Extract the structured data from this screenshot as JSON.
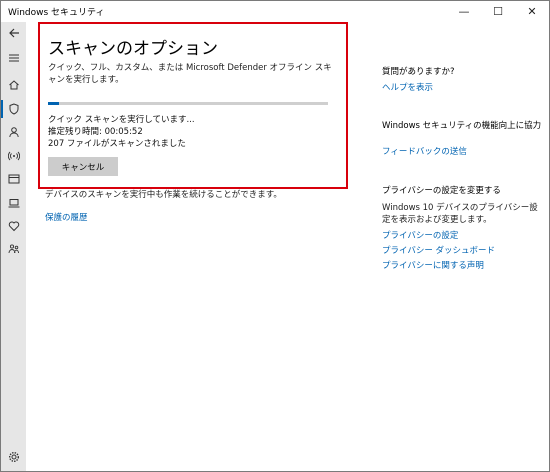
{
  "window": {
    "title": "Windows セキュリティ",
    "controls": {
      "minimize": "—",
      "maximize": "☐",
      "close": "✕"
    }
  },
  "sidebar": {
    "back_icon": "back-arrow-icon",
    "items": [
      {
        "icon": "hamburger-menu-icon"
      },
      {
        "icon": "home-icon"
      },
      {
        "icon": "shield-icon",
        "active": true
      },
      {
        "icon": "person-icon"
      },
      {
        "icon": "wireless-icon"
      },
      {
        "icon": "browser-window-icon"
      },
      {
        "icon": "laptop-icon"
      },
      {
        "icon": "heart-icon"
      },
      {
        "icon": "family-icon"
      }
    ],
    "settings_icon": "gear-icon"
  },
  "scan_card": {
    "title": "スキャンのオプション",
    "description": "クイック、フル、カスタム、または Microsoft Defender オフライン スキャンを実行します。",
    "progress": 0.04,
    "status_line": "クイック スキャンを実行しています...",
    "remaining_time": "推定残り時間: 00:05:52",
    "files_scanned": "207 ファイルがスキャンされました",
    "cancel_label": "キャンセル"
  },
  "main": {
    "continue_text": "デバイスのスキャンを実行中も作業を続けることができます。",
    "history_link": "保護の履歴"
  },
  "right_panel": {
    "question": {
      "heading": "質問がありますか?",
      "link": "ヘルプを表示"
    },
    "improve": {
      "heading": "Windows セキュリティの機能向上に協力",
      "link": "フィードバックの送信"
    },
    "privacy": {
      "heading": "プライバシーの設定を変更する",
      "text": "Windows 10 デバイスのプライバシー設定を表示および変更します。",
      "links": [
        "プライバシーの設定",
        "プライバシー ダッシュボード",
        "プライバシーに関する声明"
      ]
    }
  },
  "colors": {
    "accent": "#0063b1",
    "highlight_border": "#d8000c",
    "sidebar_bg": "#e6e6e6"
  }
}
